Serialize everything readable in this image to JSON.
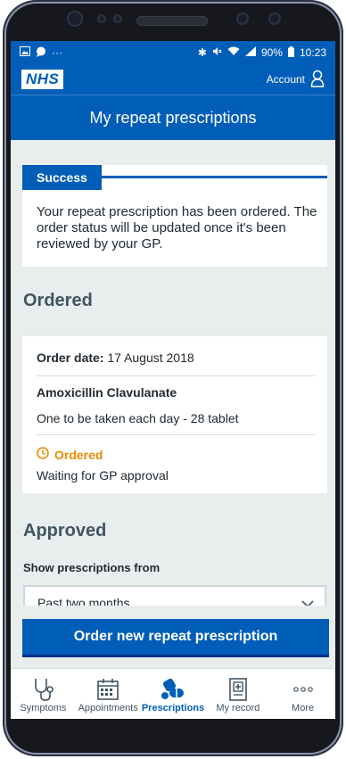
{
  "status_bar": {
    "battery": "90%",
    "time": "10:23"
  },
  "header": {
    "logo": "NHS",
    "account_label": "Account"
  },
  "page_title": "My repeat prescriptions",
  "success": {
    "label": "Success",
    "message": "Your repeat prescription has been ordered. The order status will be updated once it's been reviewed by your GP."
  },
  "ordered_section": {
    "heading": "Ordered",
    "order_date_label": "Order date:",
    "order_date": "17 August 2018",
    "drug_name": "Amoxicillin Clavulanate",
    "dosage": "One to be taken each day - 28 tablet",
    "status": "Ordered",
    "status_detail": "Waiting for GP approval",
    "status_color": "#ed8b00"
  },
  "approved_section": {
    "heading": "Approved",
    "filter_label": "Show prescriptions from",
    "filter_value": "Past two months"
  },
  "order_button_label": "Order new repeat prescription",
  "tabs": [
    {
      "label": "Symptoms",
      "icon": "stethoscope-icon"
    },
    {
      "label": "Appointments",
      "icon": "calendar-icon"
    },
    {
      "label": "Prescriptions",
      "icon": "pills-icon",
      "active": true
    },
    {
      "label": "My record",
      "icon": "medical-record-icon"
    },
    {
      "label": "More",
      "icon": "more-icon"
    }
  ],
  "colors": {
    "brand": "#005eb8",
    "background": "#e8edee",
    "warning": "#ed8b00"
  }
}
